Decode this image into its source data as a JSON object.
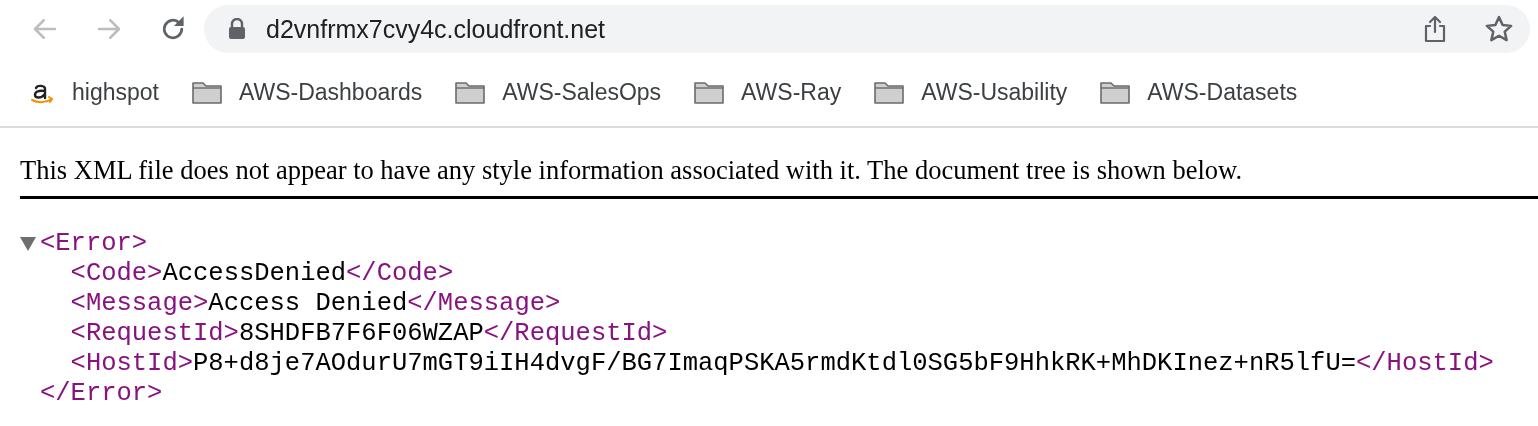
{
  "toolbar": {
    "back_disabled": true,
    "forward_disabled": true,
    "address": "d2vnfrmx7cvy4c.cloudfront.net"
  },
  "bookmarks": [
    {
      "kind": "site",
      "label": "highspot"
    },
    {
      "kind": "folder",
      "label": "AWS-Dashboards"
    },
    {
      "kind": "folder",
      "label": "AWS-SalesOps"
    },
    {
      "kind": "folder",
      "label": "AWS-Ray"
    },
    {
      "kind": "folder",
      "label": "AWS-Usability"
    },
    {
      "kind": "folder",
      "label": "AWS-Datasets"
    }
  ],
  "page": {
    "notice": "This XML file does not appear to have any style information associated with it. The document tree is shown below.",
    "tree": [
      {
        "open": "<Error>",
        "close": "</Error>",
        "expanded": true,
        "children": [
          {
            "open": "<Code>",
            "text": "AccessDenied",
            "close": "</Code>"
          },
          {
            "open": "<Message>",
            "text": "Access Denied",
            "close": "</Message>"
          },
          {
            "open": "<RequestId>",
            "text": "8SHDFB7F6F06WZAP",
            "close": "</RequestId>"
          },
          {
            "open": "<HostId>",
            "text": "P8+d8je7AOdurU7mGT9iIH4dvgF/BG7ImaqPSKA5rmdKtdl0SG5bF9HhkRK+MhDKInez+nR5lfU=",
            "close": "</HostId>"
          }
        ]
      }
    ]
  }
}
